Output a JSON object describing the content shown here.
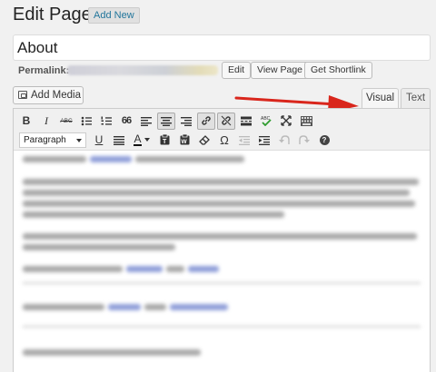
{
  "header": {
    "title": "Edit Page",
    "add_new_label": "Add New"
  },
  "post": {
    "title_value": "About"
  },
  "permalink": {
    "label": "Permalink:",
    "buttons": [
      "Edit",
      "View Page",
      "Get Shortlink"
    ]
  },
  "media": {
    "add_media_label": "Add Media",
    "icon": "media-icon"
  },
  "editor": {
    "tabs": [
      "Visual",
      "Text"
    ],
    "active_tab": "Visual",
    "format_select_value": "Paragraph",
    "toolbar_row1_icons": [
      "bold-icon",
      "italic-icon",
      "strikethrough-icon",
      "bullet-list-icon",
      "numbered-list-icon",
      "blockquote-icon",
      "align-left-icon",
      "align-center-icon",
      "align-right-icon",
      "insert-link-icon",
      "remove-link-icon",
      "insert-more-icon",
      "spellcheck-icon",
      "fullscreen-icon",
      "kitchen-sink-icon"
    ],
    "toolbar_row2_icons": [
      "underline-icon",
      "justify-icon",
      "text-color-icon",
      "paste-text-icon",
      "paste-word-icon",
      "clear-formatting-icon",
      "special-character-icon",
      "outdent-icon",
      "indent-icon",
      "undo-icon",
      "redo-icon",
      "help-icon"
    ],
    "glyphs": {
      "bold": "B",
      "italic": "I",
      "strikethrough": "ABC",
      "blockquote": "66",
      "underline": "U",
      "text_color": "A",
      "special_character": "Ω",
      "help": "?"
    }
  },
  "annotation": {
    "arrow_color": "#d9261c",
    "points_to": "Visual"
  },
  "colors": {
    "link": "#21759b",
    "background": "#f1f1f1"
  }
}
